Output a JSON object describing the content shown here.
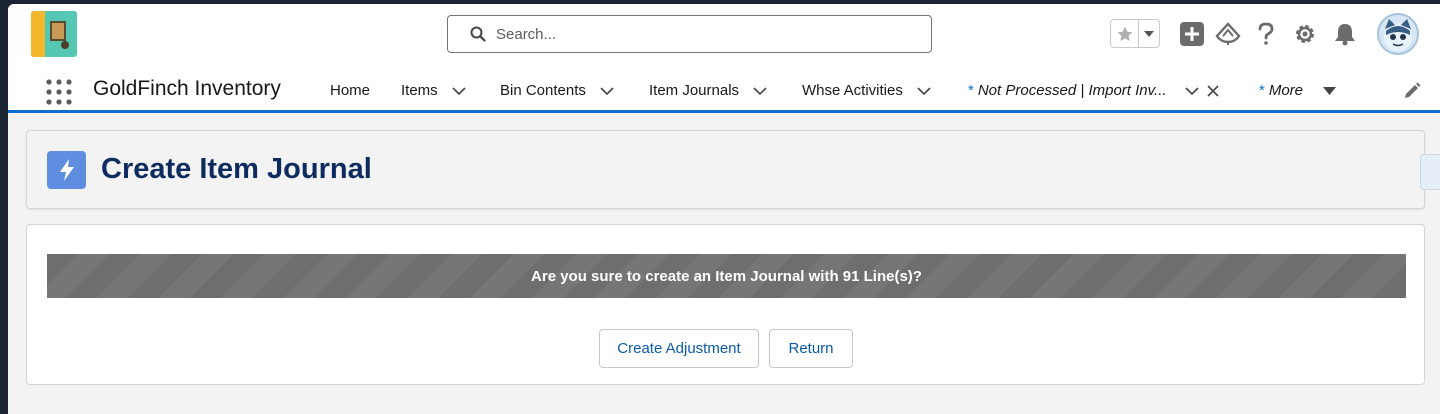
{
  "header": {
    "search_placeholder": "Search...",
    "icons": [
      "star-icon",
      "chevron-down-icon",
      "add-icon",
      "trailhead-icon",
      "help-icon",
      "gear-icon",
      "bell-icon",
      "avatar"
    ]
  },
  "nav": {
    "app_name": "GoldFinch Inventory",
    "items": [
      {
        "label": "Home"
      },
      {
        "label": "Items"
      },
      {
        "label": "Bin Contents"
      },
      {
        "label": "Item Journals"
      },
      {
        "label": "Whse Activities"
      },
      {
        "label": "Not Processed | Import Inv...",
        "marker": "*"
      },
      {
        "label": "More",
        "marker": "*"
      }
    ]
  },
  "page": {
    "title": "Create Item Journal"
  },
  "confirm": {
    "message": "Are you sure to create an Item Journal with 91 Line(s)?",
    "create_label": "Create Adjustment",
    "return_label": "Return"
  },
  "colors": {
    "brand_blue": "#0b6fd1",
    "title_color": "#0d2b5e",
    "banner_gray": "#707070",
    "link_blue": "#0b5cab"
  }
}
